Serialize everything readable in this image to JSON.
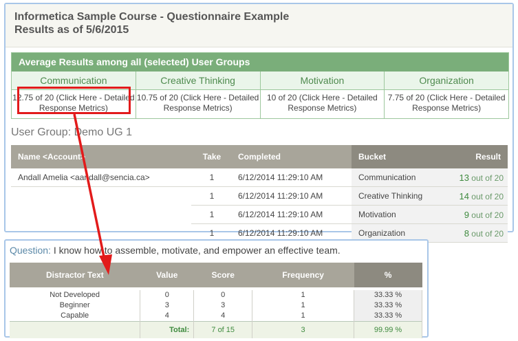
{
  "header": {
    "title": "Informetica Sample Course - Questionnaire Example",
    "subtitle": "Results as of 5/6/2015"
  },
  "averages": {
    "title": "Average Results among all (selected) User Groups",
    "columns": [
      {
        "name": "Communication",
        "value": "12.75 of 20 (Click Here - Detailed Response Metrics)"
      },
      {
        "name": "Creative Thinking",
        "value": "10.75 of 20 (Click Here - Detailed Response Metrics)"
      },
      {
        "name": "Motivation",
        "value": "10 of 20 (Click Here - Detailed Response Metrics)"
      },
      {
        "name": "Organization",
        "value": "7.75 of 20 (Click Here - Detailed Response Metrics)"
      }
    ]
  },
  "user_group": {
    "title": "User Group: Demo UG 1",
    "headers": {
      "name": "Name <Account>",
      "take": "Take",
      "completed": "Completed",
      "bucket": "Bucket",
      "result": "Result"
    },
    "name": "Andall Amelia <aandall@sencia.ca>",
    "rows": [
      {
        "take": "1",
        "completed": "6/12/2014 11:29:10 AM",
        "bucket": "Communication",
        "score": "13",
        "out_of": "out of 20"
      },
      {
        "take": "1",
        "completed": "6/12/2014 11:29:10 AM",
        "bucket": "Creative Thinking",
        "score": "14",
        "out_of": "out of 20"
      },
      {
        "take": "1",
        "completed": "6/12/2014 11:29:10 AM",
        "bucket": "Motivation",
        "score": "9",
        "out_of": "out of 20"
      },
      {
        "take": "1",
        "completed": "6/12/2014 11:29:10 AM",
        "bucket": "Organization",
        "score": "8",
        "out_of": "out of 20"
      }
    ]
  },
  "question": {
    "label": "Question:",
    "text": "I know how to assemble, motivate, and empower an effective team.",
    "headers": {
      "distractor": "Distractor Text",
      "value": "Value",
      "score": "Score",
      "frequency": "Frequency",
      "pct": "%"
    },
    "rows": [
      {
        "distractor": "Not Developed",
        "value": "0",
        "score": "0",
        "frequency": "1",
        "pct": "33.33 %"
      },
      {
        "distractor": "Beginner",
        "value": "3",
        "score": "3",
        "frequency": "1",
        "pct": "33.33 %"
      },
      {
        "distractor": "Capable",
        "value": "4",
        "score": "4",
        "frequency": "1",
        "pct": "33.33 %"
      }
    ],
    "total": {
      "label": "Total:",
      "score": "7 of 15",
      "frequency": "3",
      "pct": "99.99 %"
    }
  }
}
